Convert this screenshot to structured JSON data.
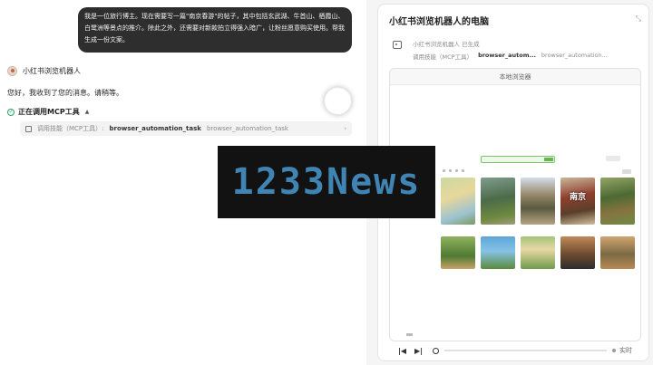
{
  "chat": {
    "user_message": "我是一位旅行博主。现在需要写一篇\"南京春游\"的帖子，其中包括玄武湖、牛首山、栖霞山、白鹭洲等景点的推介。除此之外，还需要对新款拍立得强入暗广，让粉丝愿意购买使用。帮我生成一份文案。",
    "bot_name": "小红书浏览机器人",
    "bot_reply": "您好，我收到了您的消息。请稍等。",
    "mcp_status": "正在调用MCP工具",
    "tool_call": {
      "kind": "调用技能（MCP工具）:",
      "name": "browser_automation_task",
      "subtitle": "browser_automation_task"
    }
  },
  "panel": {
    "title": "小红书浏览机器人的电脑",
    "source_line1": "小红书浏览机器人 已生成",
    "source_kind": "调用技能（MCP工具）",
    "source_name": "browser_autom...",
    "source_sub": "browser_automation...",
    "browser_title": "本地浏览器",
    "thumb_overlay": "南京",
    "live_label": "实时"
  },
  "icons": {
    "avatar": "robot-avatar",
    "status": "check-circle-icon",
    "collapse": "collapse-icon",
    "tool": "tool-icon",
    "prev": "skip-back-icon",
    "next": "skip-forward-icon"
  },
  "watermark": "1233News"
}
